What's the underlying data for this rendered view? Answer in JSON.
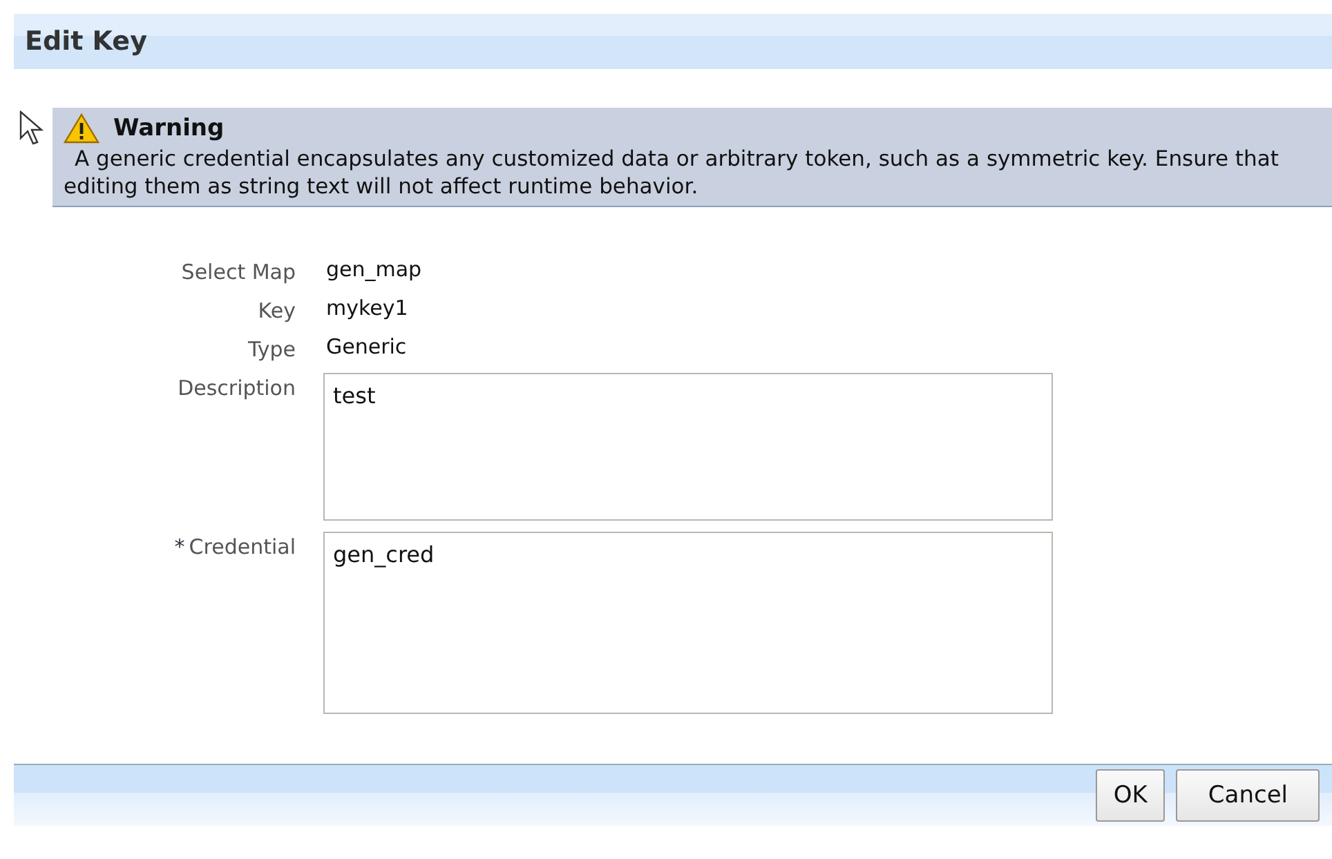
{
  "header": {
    "title": "Edit Key"
  },
  "warning": {
    "title": "Warning",
    "message": "A generic credential encapsulates any customized data or arbitrary token, such as a symmetric key. Ensure that editing them as string text will not affect runtime behavior."
  },
  "fields": [
    {
      "label": "Select Map",
      "kind": "text",
      "value": "gen_map"
    },
    {
      "label": "Key",
      "kind": "text",
      "value": "mykey1"
    },
    {
      "label": "Type",
      "kind": "text",
      "value": "Generic"
    },
    {
      "label": "Description",
      "kind": "textarea",
      "value": "test"
    },
    {
      "label": "Credential",
      "kind": "textarea",
      "value": "gen_cred",
      "required_mark": "*"
    }
  ],
  "buttons": [
    "OK",
    "Cancel"
  ]
}
